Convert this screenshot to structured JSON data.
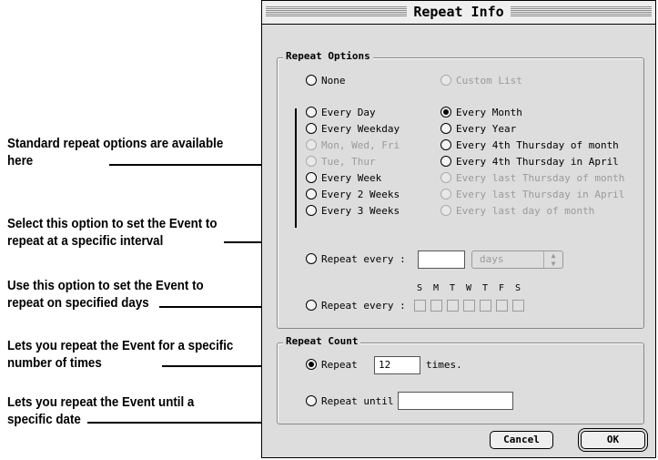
{
  "annotations": {
    "standard_repeat": "Standard repeat options are available here",
    "repeat_interval": "Select this option to set the Event to repeat at a specific interval",
    "repeat_days": "Use this option to set the Event to repeat on specified days",
    "repeat_count": "Lets you repeat the Event for a specific number of times",
    "repeat_until": "Lets you repeat the Event until a specific date"
  },
  "dialog": {
    "title": "Repeat Info",
    "repeat_options": {
      "label": "Repeat Options",
      "none": "None",
      "custom_list": "Custom List",
      "left_column": [
        "Every Day",
        "Every Weekday",
        "Mon, Wed, Fri",
        "Tue, Thur",
        "Every Week",
        "Every 2 Weeks",
        "Every 3 Weeks"
      ],
      "right_column": [
        "Every Month",
        "Every Year",
        "Every 4th Thursday of month",
        "Every 4th Thursday in April",
        "Every last Thursday of month",
        "Every last Thursday in April",
        "Every last day of month"
      ],
      "selected": "Every Month",
      "repeat_every_interval": {
        "label": "Repeat every :",
        "value": "",
        "unit": "days"
      },
      "repeat_every_days": {
        "label": "Repeat every :",
        "days": [
          "S",
          "M",
          "T",
          "W",
          "T",
          "F",
          "S"
        ]
      }
    },
    "repeat_count": {
      "label": "Repeat Count",
      "repeat_label": "Repeat",
      "repeat_value": "12",
      "times_label": "times.",
      "until_label": "Repeat until",
      "until_value": ""
    },
    "buttons": {
      "cancel": "Cancel",
      "ok": "OK"
    }
  }
}
